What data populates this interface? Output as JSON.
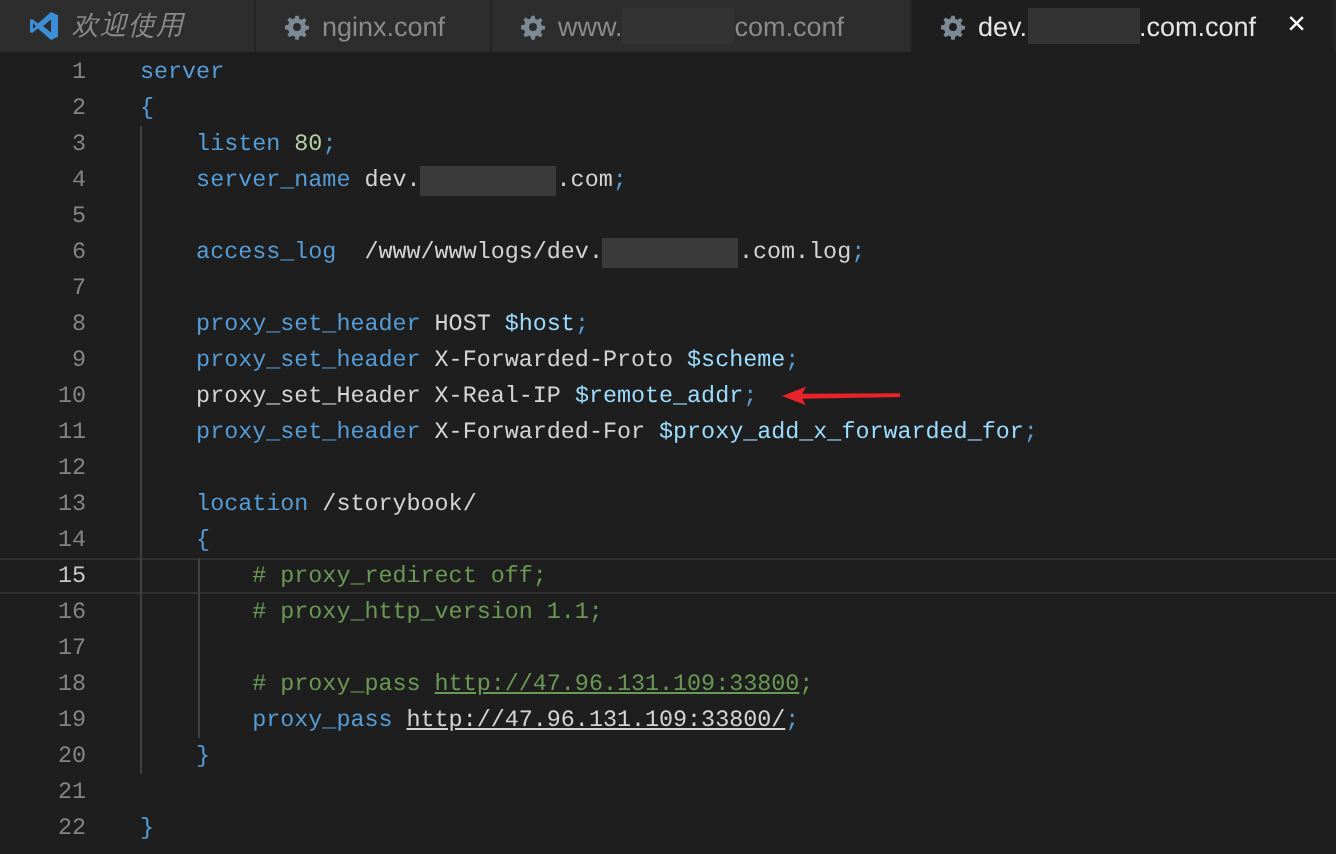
{
  "tabs": [
    {
      "kind": "welcome",
      "title": [
        {
          "kind": "text",
          "text": "欢迎使用"
        }
      ],
      "selected": false
    },
    {
      "kind": "file",
      "title": [
        {
          "kind": "text",
          "text": "nginx.conf"
        }
      ],
      "selected": false
    },
    {
      "kind": "file",
      "title": [
        {
          "kind": "text",
          "text": "www."
        },
        {
          "kind": "redacted"
        },
        {
          "kind": "text",
          "text": "com.conf"
        }
      ],
      "selected": false
    },
    {
      "kind": "file",
      "title": [
        {
          "kind": "text",
          "text": "dev."
        },
        {
          "kind": "redacted"
        },
        {
          "kind": "text",
          "text": ".com.conf"
        }
      ],
      "selected": true,
      "close": "×"
    }
  ],
  "editor": {
    "lines": [
      {
        "number": "1",
        "current": false,
        "tokens": [
          {
            "kind": "keyword",
            "text": "server"
          }
        ]
      },
      {
        "number": "2",
        "current": false,
        "tokens": [
          {
            "kind": "punct",
            "text": "{"
          }
        ]
      },
      {
        "number": "3",
        "current": false,
        "tokens": [
          {
            "kind": "keyword",
            "text": "    listen "
          },
          {
            "kind": "number",
            "text": "80"
          },
          {
            "kind": "punct",
            "text": ";"
          }
        ]
      },
      {
        "number": "4",
        "current": false,
        "tokens": [
          {
            "kind": "keyword",
            "text": "    server_name"
          },
          {
            "kind": "plain",
            "text": " dev."
          },
          {
            "kind": "redacted"
          },
          {
            "kind": "plain",
            "text": ".com"
          },
          {
            "kind": "punct",
            "text": ";"
          }
        ]
      },
      {
        "number": "5",
        "current": false
      },
      {
        "number": "6",
        "current": false,
        "tokens": [
          {
            "kind": "keyword",
            "text": "    access_log"
          },
          {
            "kind": "plain",
            "text": "  /www/wwwlogs/dev."
          },
          {
            "kind": "redacted"
          },
          {
            "kind": "plain",
            "text": ".com.log"
          },
          {
            "kind": "punct",
            "text": ";"
          }
        ]
      },
      {
        "number": "7",
        "current": false
      },
      {
        "number": "8",
        "current": false,
        "tokens": [
          {
            "kind": "keyword",
            "text": "    proxy_set_header"
          },
          {
            "kind": "plain",
            "text": " HOST "
          },
          {
            "kind": "variable",
            "text": "$host"
          },
          {
            "kind": "punct",
            "text": ";"
          }
        ]
      },
      {
        "number": "9",
        "current": false,
        "tokens": [
          {
            "kind": "keyword",
            "text": "    proxy_set_header"
          },
          {
            "kind": "plain",
            "text": " X-Forwarded-Proto "
          },
          {
            "kind": "variable",
            "text": "$scheme"
          },
          {
            "kind": "punct",
            "text": ";"
          }
        ]
      },
      {
        "number": "10",
        "current": false,
        "annotated": true,
        "tokens": [
          {
            "kind": "plain",
            "text": "    proxy_set_Header X-Real-IP "
          },
          {
            "kind": "variable",
            "text": "$remote_addr"
          },
          {
            "kind": "punct",
            "text": ";"
          }
        ]
      },
      {
        "number": "11",
        "current": false,
        "tokens": [
          {
            "kind": "keyword",
            "text": "    proxy_set_header"
          },
          {
            "kind": "plain",
            "text": " X-Forwarded-For "
          },
          {
            "kind": "variable",
            "text": "$proxy_add_x_forwarded_for"
          },
          {
            "kind": "punct",
            "text": ";"
          }
        ]
      },
      {
        "number": "12",
        "current": false
      },
      {
        "number": "13",
        "current": false,
        "tokens": [
          {
            "kind": "keyword",
            "text": "    location"
          },
          {
            "kind": "plain",
            "text": " /storybook/"
          }
        ]
      },
      {
        "number": "14",
        "current": false,
        "tokens": [
          {
            "kind": "punct",
            "text": "    {"
          }
        ]
      },
      {
        "number": "15",
        "current": true,
        "tokens": [
          {
            "kind": "comment",
            "text": "        # proxy_redirect off;"
          }
        ]
      },
      {
        "number": "16",
        "current": false,
        "tokens": [
          {
            "kind": "comment",
            "text": "        # proxy_http_version 1.1;"
          }
        ]
      },
      {
        "number": "17",
        "current": false
      },
      {
        "number": "18",
        "current": false,
        "tokens": [
          {
            "kind": "comment",
            "text": "        # proxy_pass "
          },
          {
            "kind": "comment-link",
            "text": "http://47.96.131.109:33800"
          },
          {
            "kind": "comment",
            "text": ";"
          }
        ]
      },
      {
        "number": "19",
        "current": false,
        "tokens": [
          {
            "kind": "keyword",
            "text": "        proxy_pass "
          },
          {
            "kind": "link",
            "text": "http://47.96.131.109:33800/"
          },
          {
            "kind": "punct",
            "text": ";"
          }
        ]
      },
      {
        "number": "20",
        "current": false,
        "tokens": [
          {
            "kind": "punct",
            "text": "    }"
          }
        ]
      },
      {
        "number": "21",
        "current": false
      },
      {
        "number": "22",
        "current": false,
        "tokens": [
          {
            "kind": "punct",
            "text": "}"
          }
        ]
      }
    ]
  }
}
